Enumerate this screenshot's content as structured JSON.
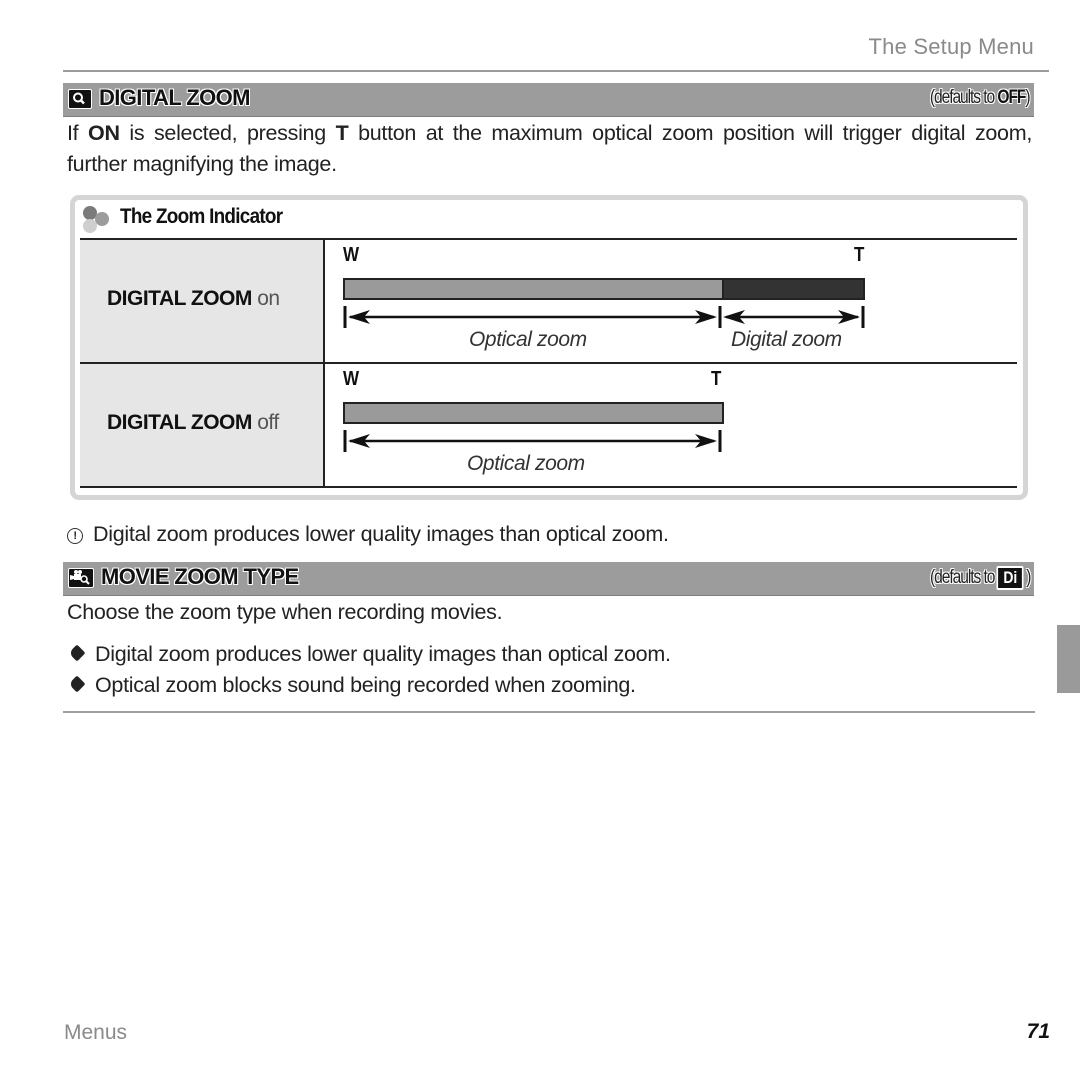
{
  "header": {
    "running_head": "The Setup Menu"
  },
  "digital_zoom": {
    "icon": "magnifier-icon",
    "title": "DIGITAL ZOOM",
    "default_prefix": "(defaults to ",
    "default_value": "OFF",
    "default_suffix": ")",
    "description_parts": [
      "If ",
      "ON",
      " is selected, pressing ",
      "T",
      " button at the maximum optical zoom position will trigger digital zoom, further magnifying the image."
    ]
  },
  "zoom_indicator": {
    "icon": "hint-icon",
    "title": "The Zoom Indicator",
    "rows": [
      {
        "label_bold": "DIGITAL ZOOM",
        "label_state": "on",
        "w_label": "W",
        "t_label": "T",
        "optical_caption": "Optical zoom",
        "digital_caption": "Digital zoom",
        "optical_fraction": 0.73,
        "digital_fraction": 0.27
      },
      {
        "label_bold": "DIGITAL ZOOM",
        "label_state": "off",
        "w_label": "W",
        "t_label": "T",
        "optical_caption": "Optical zoom",
        "optical_fraction": 1.0
      }
    ]
  },
  "caution": {
    "icon": "caution-icon",
    "text": "Digital zoom produces lower quality images than optical zoom."
  },
  "movie_zoom_type": {
    "icon": "movie-zoom-icon",
    "title": "MOVIE ZOOM TYPE",
    "default_prefix": "(defaults to",
    "default_value": "Di",
    "default_suffix": ")",
    "description": "Choose the zoom type when recording movies.",
    "notes": [
      "Digital zoom produces lower quality images than optical zoom.",
      "Optical zoom blocks sound being recorded when zooming."
    ]
  },
  "footer": {
    "section": "Menus",
    "page_number": "71"
  }
}
